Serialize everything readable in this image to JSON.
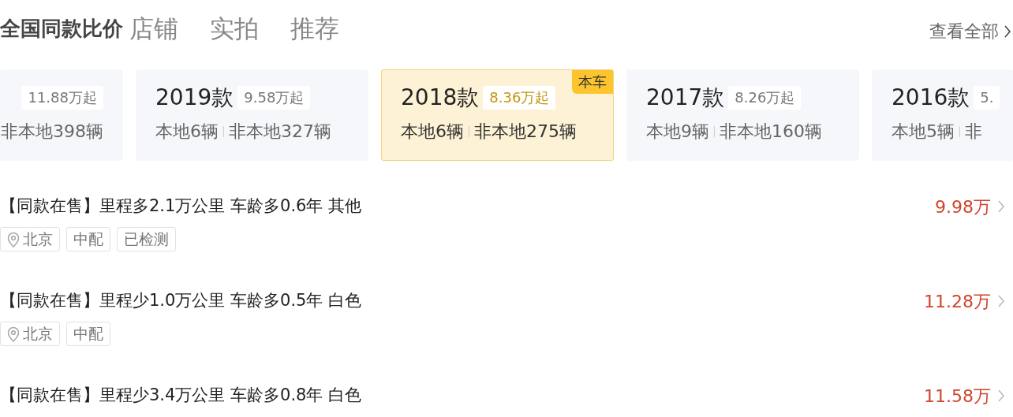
{
  "header": {
    "title": "全国同款比价",
    "tabs": [
      {
        "label": "店铺",
        "selected": false
      },
      {
        "label": "实拍",
        "selected": false
      },
      {
        "label": "推荐",
        "selected": false
      }
    ],
    "view_all": "查看全部"
  },
  "model_years": [
    {
      "price": "11.88万起",
      "nonlocal": "非本地398辆",
      "current": false
    },
    {
      "year": "2019款",
      "price": "9.58万起",
      "local": "本地6辆",
      "nonlocal": "非本地327辆",
      "current": false
    },
    {
      "year": "2018款",
      "price": "8.36万起",
      "local": "本地6辆",
      "nonlocal": "非本地275辆",
      "current": true,
      "badge": "本车"
    },
    {
      "year": "2017款",
      "price": "8.26万起",
      "local": "本地9辆",
      "nonlocal": "非本地160辆",
      "current": false
    },
    {
      "year": "2016款",
      "price": "5.",
      "local": "本地5辆",
      "nonlocal": "非",
      "current": false
    }
  ],
  "listings": [
    {
      "title": "【同款在售】里程多2.1万公里 车龄多0.6年 其他",
      "price": "9.98万",
      "tags": [
        {
          "kind": "location",
          "label": "北京"
        },
        {
          "kind": "plain",
          "label": "中配"
        },
        {
          "kind": "plain",
          "label": "已检测"
        }
      ]
    },
    {
      "title": "【同款在售】里程少1.0万公里 车龄多0.5年 白色",
      "price": "11.28万",
      "tags": [
        {
          "kind": "location",
          "label": "北京"
        },
        {
          "kind": "plain",
          "label": "中配"
        }
      ]
    },
    {
      "title": "【同款在售】里程少3.4万公里 车龄多0.8年 白色",
      "price": "11.58万"
    }
  ]
}
